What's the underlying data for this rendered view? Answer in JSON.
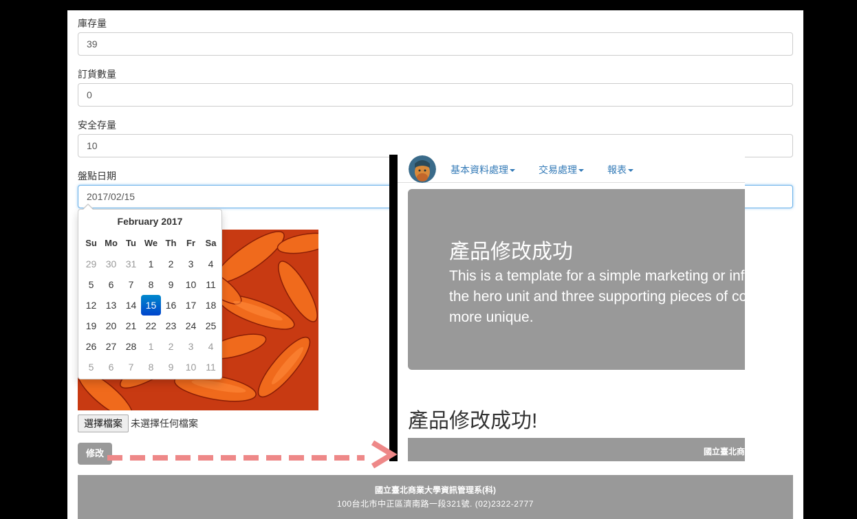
{
  "form": {
    "stock_label": "庫存量",
    "stock_value": "39",
    "order_label": "訂貨數量",
    "order_value": "0",
    "safety_label": "安全存量",
    "safety_value": "10",
    "date_label": "盤點日期",
    "date_value": "2017/02/15",
    "file_button": "選擇檔案",
    "file_status": "未選擇任何檔案",
    "submit": "修改"
  },
  "datepicker": {
    "title": "February 2017",
    "weekdays": [
      "Su",
      "Mo",
      "Tu",
      "We",
      "Th",
      "Fr",
      "Sa"
    ],
    "weeks": [
      [
        "29",
        "30",
        "31",
        "1",
        "2",
        "3",
        "4"
      ],
      [
        "5",
        "6",
        "7",
        "8",
        "9",
        "10",
        "11"
      ],
      [
        "12",
        "13",
        "14",
        "15",
        "16",
        "17",
        "18"
      ],
      [
        "19",
        "20",
        "21",
        "22",
        "23",
        "24",
        "25"
      ],
      [
        "26",
        "27",
        "28",
        "1",
        "2",
        "3",
        "4"
      ],
      [
        "5",
        "6",
        "7",
        "8",
        "9",
        "10",
        "11"
      ]
    ],
    "selected": "15",
    "accent": "#0066cc"
  },
  "footer": {
    "line1": "國立臺北商業大學資訊管理系(科)",
    "line2": "100台北市中正區濟南路一段321號. (02)2322-2777"
  },
  "overlay": {
    "nav": [
      "基本資料處理",
      "交易處理",
      "報表"
    ],
    "hero_title": "產品修改成功",
    "hero_text": "This is a template for a simple marketing or inf\nthe hero unit and three supporting pieces of co\nmore unique.",
    "message": "產品修改成功!",
    "footer_text": "國立臺北商"
  },
  "colors": {
    "hero_bg": "#999999",
    "arrow": "#ee8888",
    "link": "#337ab7"
  }
}
